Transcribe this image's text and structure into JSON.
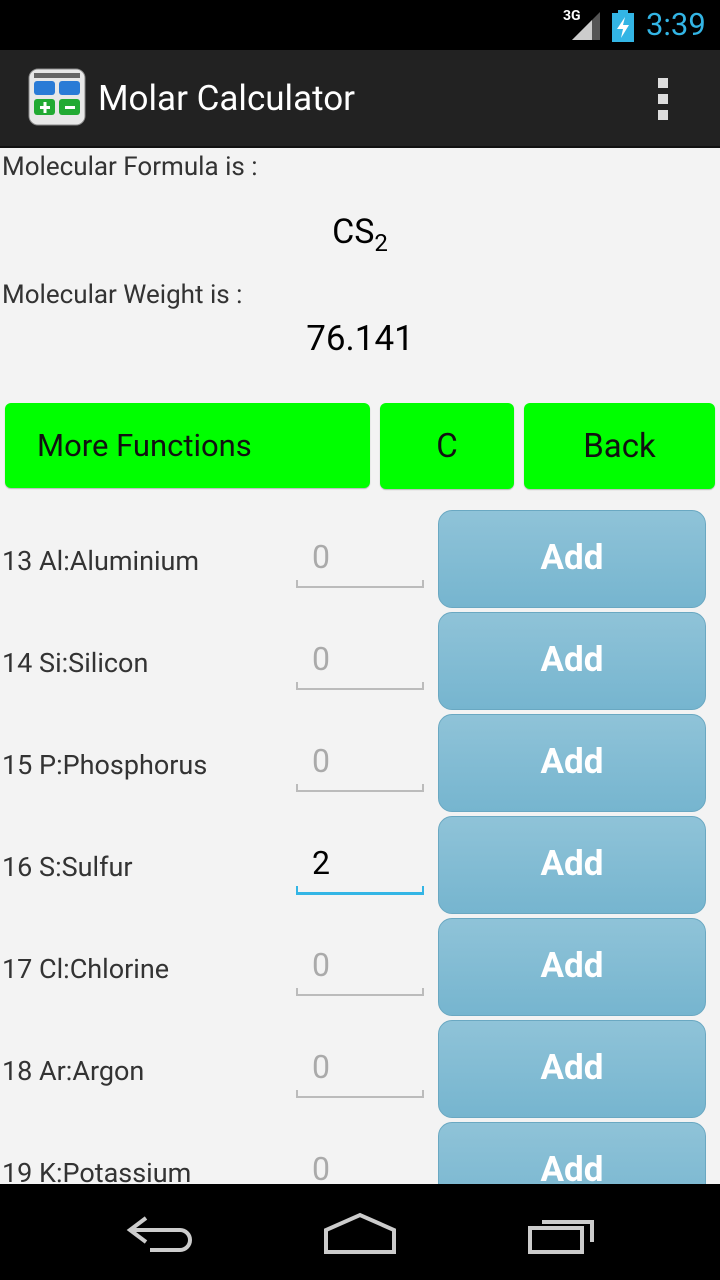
{
  "status_bar": {
    "network": "3G",
    "time": "3:39"
  },
  "app": {
    "title": "Molar Calculator"
  },
  "result": {
    "formula_label": "Molecular Formula is :",
    "formula_base": "CS",
    "formula_subscript": "2",
    "weight_label": "Molecular Weight is :",
    "weight_value": "76.141"
  },
  "buttons": {
    "more_functions": "More Functions",
    "carbon": "C",
    "back": "Back"
  },
  "elements": [
    {
      "name": "13 Al:Aluminium",
      "count": "0",
      "add_label": "Add"
    },
    {
      "name": "14 Si:Silicon",
      "count": "0",
      "add_label": "Add"
    },
    {
      "name": "15 P:Phosphorus",
      "count": "0",
      "add_label": "Add"
    },
    {
      "name": "16 S:Sulfur",
      "count": "2",
      "add_label": "Add"
    },
    {
      "name": "17 Cl:Chlorine",
      "count": "0",
      "add_label": "Add"
    },
    {
      "name": "18 Ar:Argon",
      "count": "0",
      "add_label": "Add"
    },
    {
      "name": "19 K:Potassium",
      "count": "0",
      "add_label": "Add"
    }
  ],
  "colors": {
    "green_button": "#00ff00",
    "add_button": "#7ab8d2",
    "clock": "#33b5e5"
  },
  "icons": [
    "signal-icon",
    "battery-charging-icon",
    "app-icon",
    "overflow-menu-icon",
    "back-nav-icon",
    "home-nav-icon",
    "recent-apps-icon"
  ]
}
